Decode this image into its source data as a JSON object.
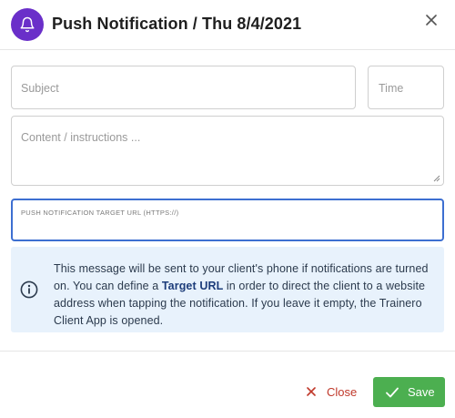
{
  "header": {
    "title": "Push Notification / Thu 8/4/2021",
    "bell_icon": "bell-icon",
    "close_icon": "close-icon"
  },
  "form": {
    "subject_placeholder": "Subject",
    "time_placeholder": "Time",
    "content_placeholder": "Content / instructions ...",
    "url_label": "PUSH NOTIFICATION TARGET URL (HTTPS://)",
    "url_value": ""
  },
  "info": {
    "icon": "info-circle-icon",
    "text_before": "This message will be sent to your client's phone if notifications are turned on. You can define a ",
    "text_bold": "Target URL",
    "text_after": " in order to direct the client to a website address when tapping the notification. If you leave it empty, the Trainero Client App is opened."
  },
  "footer": {
    "close_label": "Close",
    "save_label": "Save"
  },
  "colors": {
    "accent": "#6a2fc9",
    "focus_border": "#3d6fd1",
    "info_bg": "#e8f2fc",
    "close_red": "#c0392b",
    "save_green": "#4caf50"
  }
}
